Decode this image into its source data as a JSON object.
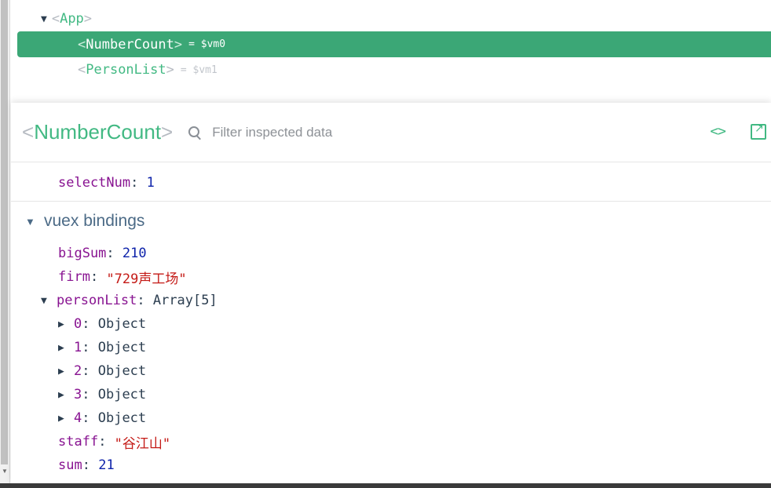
{
  "tree": {
    "app": {
      "name": "App"
    },
    "selected": {
      "name": "NumberCount",
      "vm": "= $vm0"
    },
    "person": {
      "name": "PersonList",
      "vm": "= $vm1"
    }
  },
  "inspector": {
    "title": "NumberCount",
    "filter_placeholder": "Filter inspected data",
    "code_icon": "<>",
    "data": {
      "key": "selectNum",
      "value": "1"
    },
    "vuex": {
      "title": "vuex bindings",
      "bigSum": {
        "key": "bigSum",
        "value": "210"
      },
      "firm": {
        "key": "firm",
        "value": "\"729声工场\""
      },
      "personList": {
        "key": "personList",
        "value": "Array[5]"
      },
      "items": [
        {
          "index": "0",
          "value": "Object"
        },
        {
          "index": "1",
          "value": "Object"
        },
        {
          "index": "2",
          "value": "Object"
        },
        {
          "index": "3",
          "value": "Object"
        },
        {
          "index": "4",
          "value": "Object"
        }
      ],
      "staff": {
        "key": "staff",
        "value": "\"谷江山\""
      },
      "sum": {
        "key": "sum",
        "value": "21"
      }
    }
  },
  "colors": {
    "accent": "#42b983",
    "selected_bg": "#3ba776",
    "key": "#881391",
    "number": "#0d22aa",
    "string": "#c41a16"
  }
}
